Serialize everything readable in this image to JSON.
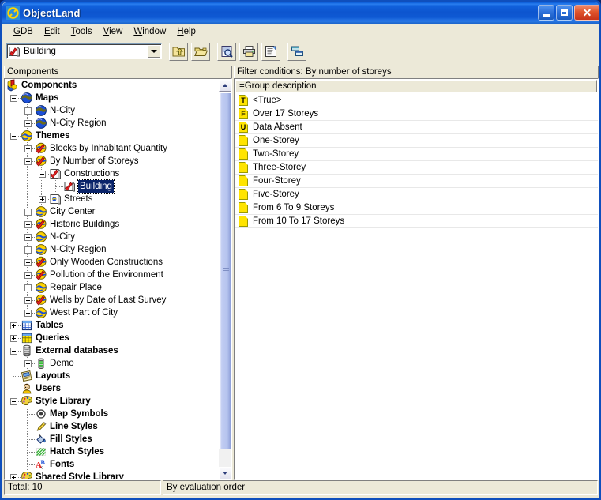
{
  "window": {
    "title": "ObjectLand",
    "title_icon": "objectland-logo-icon",
    "caption": {
      "minimize_label": "Minimize",
      "maximize_label": "Maximize",
      "close_label": "Close"
    },
    "accent_titlebar": "#0d55cf",
    "accent_close": "#c7341a",
    "face_color": "#ece9d8"
  },
  "menubar": {
    "items": [
      {
        "label": "GDB",
        "accel": "G"
      },
      {
        "label": "Edit",
        "accel": "E"
      },
      {
        "label": "Tools",
        "accel": "T"
      },
      {
        "label": "View",
        "accel": "V"
      },
      {
        "label": "Window",
        "accel": "W"
      },
      {
        "label": "Help",
        "accel": "H"
      }
    ]
  },
  "toolbar": {
    "combo": {
      "value": "Building",
      "icon": "theme-check-icon",
      "arrow_icon": "chevron-down-icon"
    },
    "buttons": [
      {
        "name": "go-up-folder-button",
        "icon": "folder-up-icon"
      },
      {
        "name": "open-folder-button",
        "icon": "folder-open-icon"
      },
      {
        "name": "preview-button",
        "icon": "magnifier-page-icon"
      },
      {
        "name": "print-button",
        "icon": "printer-icon"
      },
      {
        "name": "properties-button",
        "icon": "properties-page-icon"
      },
      {
        "name": "arrange-button",
        "icon": "arrange-windows-icon"
      }
    ]
  },
  "panels": {
    "left_header": "Components",
    "right_header": "Filter conditions: By number of storeys"
  },
  "tree": {
    "items": [
      {
        "label": "Components",
        "depth": 0,
        "expander": "none",
        "icon": "components-icon",
        "bold": true,
        "selected": false
      },
      {
        "label": "Maps",
        "depth": 1,
        "expander": "minus",
        "icon": "globe-blue-icon",
        "bold": true,
        "selected": false
      },
      {
        "label": "N-City",
        "depth": 2,
        "expander": "plus",
        "icon": "globe-blue-icon",
        "bold": false,
        "selected": false
      },
      {
        "label": "N-City Region",
        "depth": 2,
        "expander": "plus",
        "icon": "globe-blue-icon",
        "bold": false,
        "selected": false
      },
      {
        "label": "Themes",
        "depth": 1,
        "expander": "minus",
        "icon": "globe-yellow-icon",
        "bold": true,
        "selected": false
      },
      {
        "label": "Blocks by Inhabitant Quantity",
        "depth": 2,
        "expander": "plus",
        "icon": "globe-check-icon",
        "bold": false,
        "selected": false
      },
      {
        "label": "By Number of Storeys",
        "depth": 2,
        "expander": "minus",
        "icon": "globe-check-icon",
        "bold": false,
        "selected": false
      },
      {
        "label": "Constructions",
        "depth": 3,
        "expander": "minus",
        "icon": "theme-check-icon",
        "bold": false,
        "selected": false
      },
      {
        "label": "Building",
        "depth": 4,
        "expander": "none",
        "icon": "theme-check-icon",
        "bold": false,
        "selected": true
      },
      {
        "label": "Streets",
        "depth": 3,
        "expander": "plus",
        "icon": "theme-plain-icon",
        "bold": false,
        "selected": false
      },
      {
        "label": "City Center",
        "depth": 2,
        "expander": "plus",
        "icon": "globe-yellow-icon",
        "bold": false,
        "selected": false
      },
      {
        "label": "Historic Buildings",
        "depth": 2,
        "expander": "plus",
        "icon": "globe-check-icon",
        "bold": false,
        "selected": false
      },
      {
        "label": "N-City",
        "depth": 2,
        "expander": "plus",
        "icon": "globe-yellow-icon",
        "bold": false,
        "selected": false
      },
      {
        "label": "N-City Region",
        "depth": 2,
        "expander": "plus",
        "icon": "globe-yellow-icon",
        "bold": false,
        "selected": false
      },
      {
        "label": "Only Wooden Constructions",
        "depth": 2,
        "expander": "plus",
        "icon": "globe-check-icon",
        "bold": false,
        "selected": false
      },
      {
        "label": "Pollution of the Environment",
        "depth": 2,
        "expander": "plus",
        "icon": "globe-check-icon",
        "bold": false,
        "selected": false
      },
      {
        "label": "Repair Place",
        "depth": 2,
        "expander": "plus",
        "icon": "globe-yellow-icon",
        "bold": false,
        "selected": false
      },
      {
        "label": "Wells by Date of Last Survey",
        "depth": 2,
        "expander": "plus",
        "icon": "globe-check-icon",
        "bold": false,
        "selected": false
      },
      {
        "label": "West Part of City",
        "depth": 2,
        "expander": "plus",
        "icon": "globe-yellow-icon",
        "bold": false,
        "selected": false
      },
      {
        "label": "Tables",
        "depth": 1,
        "expander": "plus",
        "icon": "table-blue-icon",
        "bold": true,
        "selected": false
      },
      {
        "label": "Queries",
        "depth": 1,
        "expander": "plus",
        "icon": "table-yellow-icon",
        "bold": true,
        "selected": false
      },
      {
        "label": "External databases",
        "depth": 1,
        "expander": "minus",
        "icon": "database-gray-icon",
        "bold": true,
        "selected": false
      },
      {
        "label": "Demo",
        "depth": 2,
        "expander": "plus",
        "icon": "database-green-icon",
        "bold": false,
        "selected": false
      },
      {
        "label": "Layouts",
        "depth": 1,
        "expander": "none",
        "icon": "layouts-icon",
        "bold": true,
        "selected": false
      },
      {
        "label": "Users",
        "depth": 1,
        "expander": "none",
        "icon": "users-icon",
        "bold": true,
        "selected": false
      },
      {
        "label": "Style Library",
        "depth": 1,
        "expander": "minus",
        "icon": "palette-icon",
        "bold": true,
        "selected": false
      },
      {
        "label": "Map Symbols",
        "depth": 2,
        "expander": "none",
        "icon": "map-symbol-icon",
        "bold": true,
        "selected": false
      },
      {
        "label": "Line Styles",
        "depth": 2,
        "expander": "none",
        "icon": "line-style-icon",
        "bold": true,
        "selected": false
      },
      {
        "label": "Fill Styles",
        "depth": 2,
        "expander": "none",
        "icon": "fill-style-icon",
        "bold": true,
        "selected": false
      },
      {
        "label": "Hatch Styles",
        "depth": 2,
        "expander": "none",
        "icon": "hatch-style-icon",
        "bold": true,
        "selected": false
      },
      {
        "label": "Fonts",
        "depth": 2,
        "expander": "none",
        "icon": "fonts-icon",
        "bold": true,
        "selected": false
      },
      {
        "label": "Shared Style Library",
        "depth": 1,
        "expander": "plus",
        "icon": "palette-icon",
        "bold": true,
        "selected": false
      }
    ]
  },
  "list": {
    "column_header": "=Group description",
    "rows": [
      {
        "label": "<True>",
        "icon": "note-true-icon",
        "letter": "T"
      },
      {
        "label": "Over 17 Storeys",
        "icon": "note-false-icon",
        "letter": "F"
      },
      {
        "label": "Data Absent",
        "icon": "note-unknown-icon",
        "letter": "U"
      },
      {
        "label": "One-Storey",
        "icon": "note-icon",
        "letter": ""
      },
      {
        "label": "Two-Storey",
        "icon": "note-icon",
        "letter": ""
      },
      {
        "label": "Three-Storey",
        "icon": "note-icon",
        "letter": ""
      },
      {
        "label": "Four-Storey",
        "icon": "note-icon",
        "letter": ""
      },
      {
        "label": "Five-Storey",
        "icon": "note-icon",
        "letter": ""
      },
      {
        "label": "From 6 To 9 Storeys",
        "icon": "note-icon",
        "letter": ""
      },
      {
        "label": "From 10 To 17 Storeys",
        "icon": "note-icon",
        "letter": ""
      }
    ]
  },
  "statusbar": {
    "left": "Total: 10",
    "right": "By evaluation order"
  },
  "scrollbar": {
    "up_icon": "scroll-up-icon",
    "down_icon": "scroll-down-icon"
  }
}
